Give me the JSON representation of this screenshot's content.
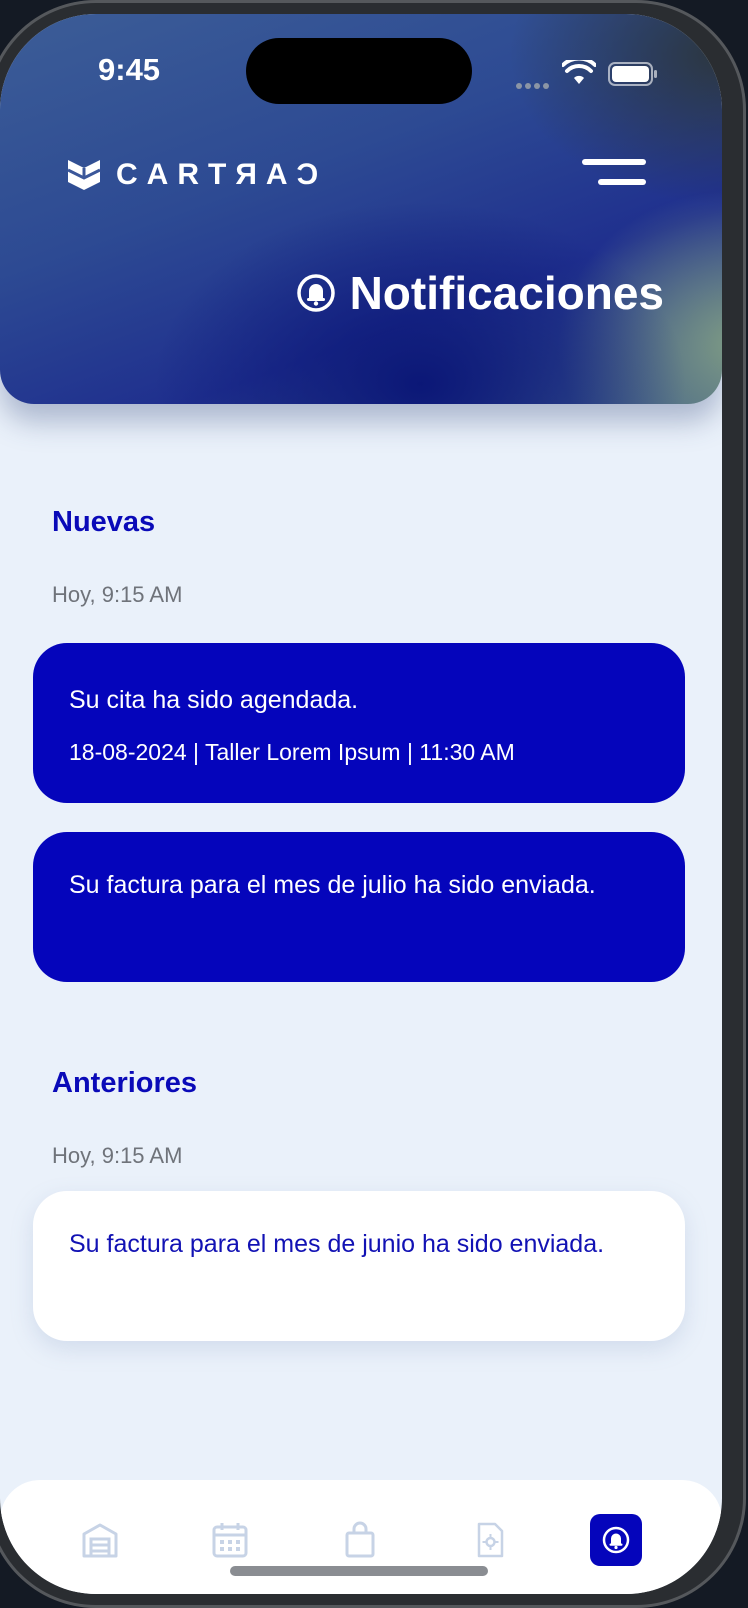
{
  "status_bar": {
    "time": "9:45"
  },
  "brand": {
    "name": "CARTRAC",
    "display_text": "CARTЯAƆ"
  },
  "header": {
    "title": "Notificaciones",
    "menu_icon": "hamburger-menu-icon",
    "title_icon": "bell-icon"
  },
  "sections": {
    "new": {
      "title": "Nuevas",
      "timestamp": "Hoy, 9:15 AM",
      "items": [
        {
          "text": "Su cita ha sido agendada.",
          "detail": "18-08-2024 | Taller Lorem Ipsum | 11:30 AM"
        },
        {
          "text": "Su factura para el mes de julio ha sido enviada."
        }
      ]
    },
    "previous": {
      "title": "Anteriores",
      "timestamp": "Hoy, 9:15 AM",
      "items": [
        {
          "text": "Su factura para el mes de junio ha sido enviada."
        }
      ]
    }
  },
  "tabbar": {
    "items": [
      {
        "icon": "garage-icon",
        "active": false
      },
      {
        "icon": "calendar-icon",
        "active": false
      },
      {
        "icon": "shopping-bag-icon",
        "active": false
      },
      {
        "icon": "document-settings-icon",
        "active": false
      },
      {
        "icon": "bell-icon",
        "active": true
      }
    ]
  },
  "colors": {
    "accent": "#0505bb",
    "background": "#eaf1fa",
    "timestamp": "#6f737a"
  }
}
